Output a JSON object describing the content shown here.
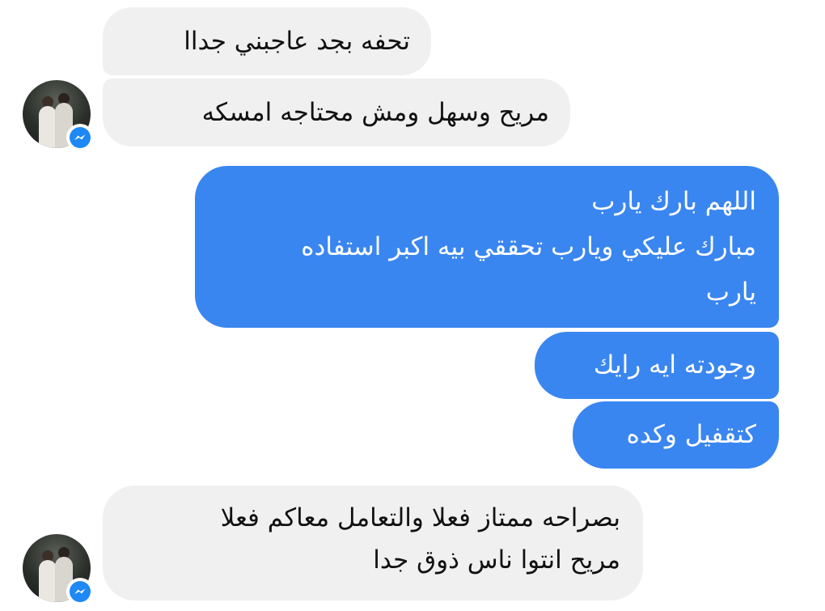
{
  "colors": {
    "incoming_bubble": "#f0f0f0",
    "outgoing_bubble": "#3a86f0",
    "messenger_badge": "#1e88f5"
  },
  "messages": [
    {
      "direction": "incoming",
      "lines": [
        "تحفه بجد عاجبني جداا"
      ]
    },
    {
      "direction": "incoming",
      "lines": [
        "مريح وسهل ومش محتاجه امسكه"
      ]
    },
    {
      "direction": "outgoing",
      "lines": [
        "اللهم بارك يارب",
        "مبارك عليكي ويارب تحققي بيه اكبر استفاده",
        "يارب"
      ]
    },
    {
      "direction": "outgoing",
      "lines": [
        "وجودته ايه رايك"
      ]
    },
    {
      "direction": "outgoing",
      "lines": [
        "كتقفيل وكده"
      ]
    },
    {
      "direction": "incoming",
      "lines": [
        "بصراحه ممتاز فعلا والتعامل معاكم فعلا",
        "مريح انتوا ناس ذوق جدا"
      ]
    }
  ],
  "avatars": [
    {
      "icon": "profile-photo",
      "badge_icon": "messenger-icon"
    },
    {
      "icon": "profile-photo",
      "badge_icon": "messenger-icon"
    }
  ]
}
